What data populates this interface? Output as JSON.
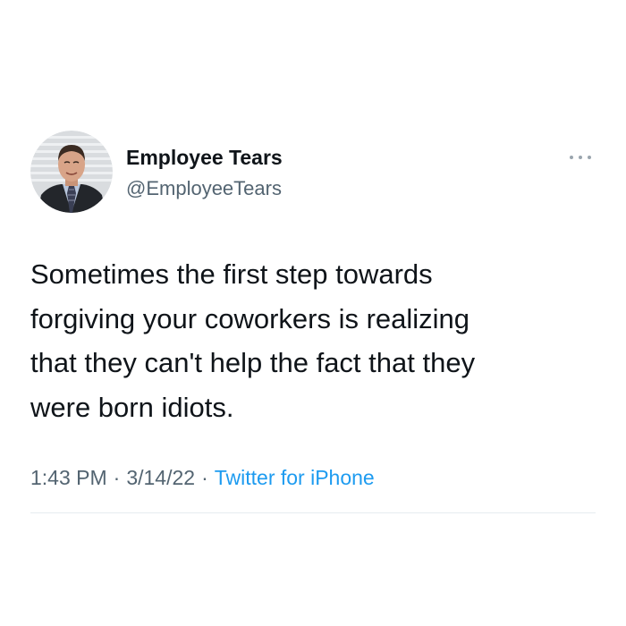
{
  "tweet": {
    "author": {
      "display_name": "Employee Tears",
      "handle": "@EmployeeTears",
      "avatar": "profile-photo"
    },
    "text": "Sometimes the first step towards\nforgiving your coworkers is realizing\nthat they can't help the fact that they\nwere born idiots.",
    "meta": {
      "time": "1:43 PM",
      "separator": "·",
      "date": "3/14/22",
      "source": "Twitter for iPhone"
    },
    "more_icon": "more-horizontal-icon"
  },
  "colors": {
    "text_primary": "#0f1419",
    "text_secondary": "#536471",
    "link": "#1d9bf0",
    "divider": "#e6ecf0",
    "more_dots": "#9aa5ae"
  }
}
